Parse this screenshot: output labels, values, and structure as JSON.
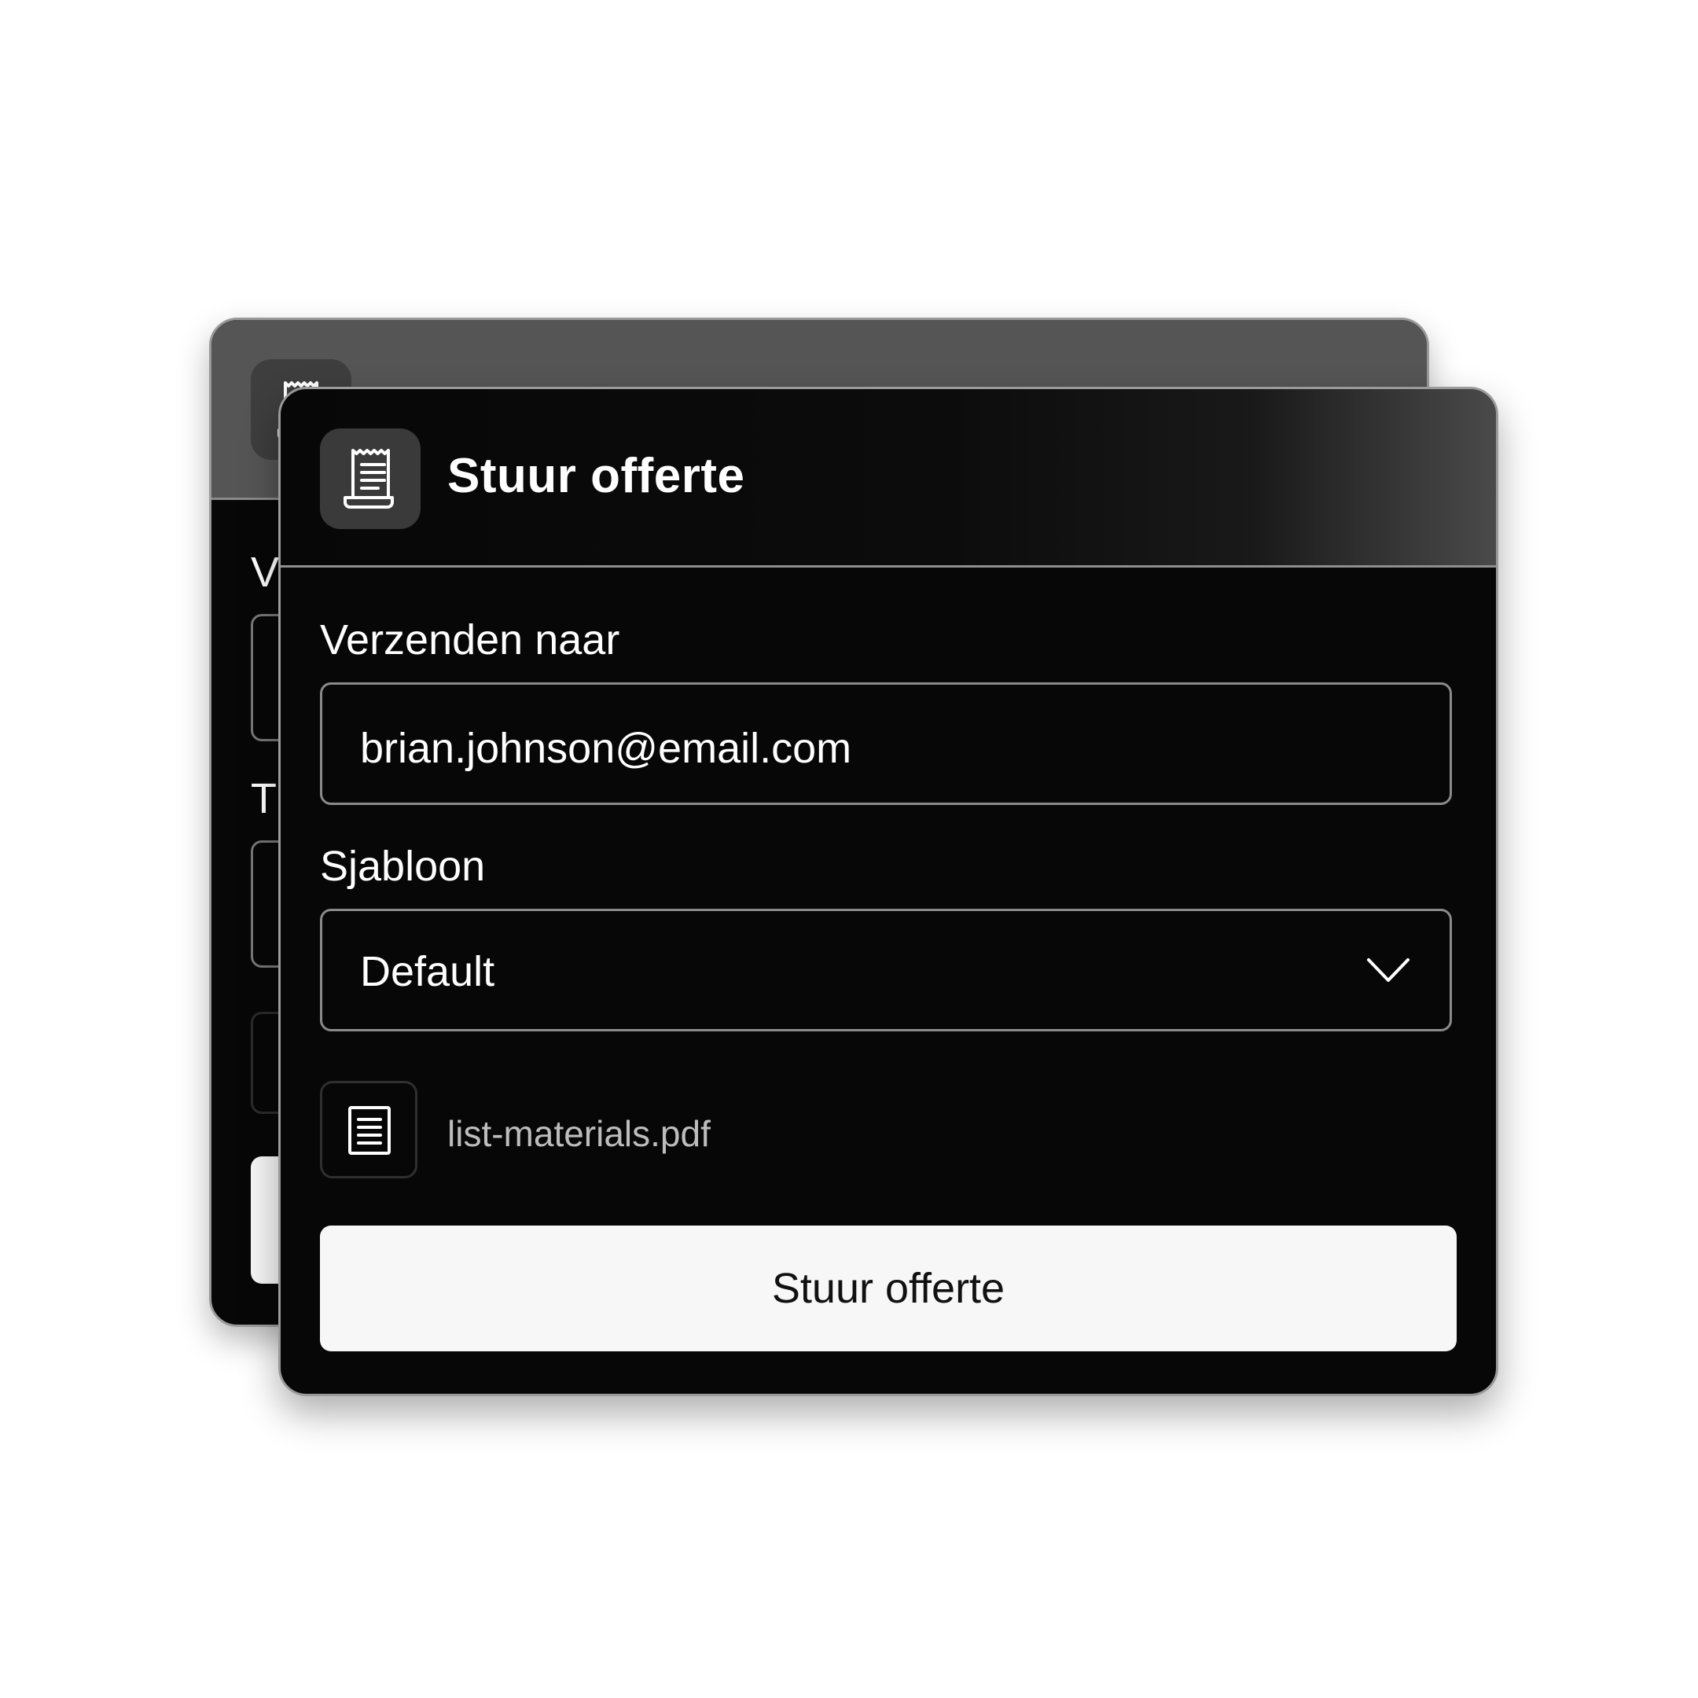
{
  "dialog": {
    "title": "Stuur offerte",
    "header_icon": "receipt-icon",
    "recipient": {
      "label": "Verzenden naar",
      "value": "brian.johnson@email.com"
    },
    "template": {
      "label": "Sjabloon",
      "selected": "Default",
      "icon": "chevron-down-icon"
    },
    "attachment": {
      "icon": "document-icon",
      "filename": "list-materials.pdf"
    },
    "submit_label": "Stuur offerte"
  },
  "background_dialog": {
    "header_icon": "receipt-icon",
    "label_1_fragment": "V",
    "label_2_fragment": "T"
  },
  "colors": {
    "page_background": "#ffffff",
    "card_background": "#070707",
    "back_header": "#555555",
    "icon_tile": "#3a3a3a",
    "field_border": "#8a8a8a",
    "button_background": "#f7f7f7",
    "button_text": "#111111",
    "muted_text": "#bdbdbd"
  }
}
